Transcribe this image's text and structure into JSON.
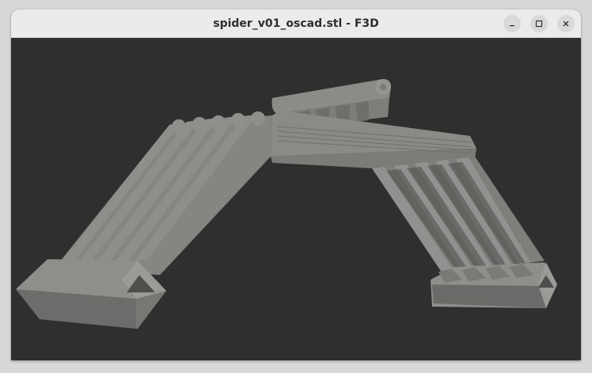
{
  "window": {
    "title": "spider_v01_oscad.stl - F3D"
  },
  "controls": {
    "minimize_icon": "minimize-icon",
    "maximize_icon": "maximize-icon",
    "close_icon": "close-icon"
  },
  "colors": {
    "titlebar": "#ebebeb",
    "viewport_background": "#2f2f2f",
    "model": "#8a8a87"
  }
}
